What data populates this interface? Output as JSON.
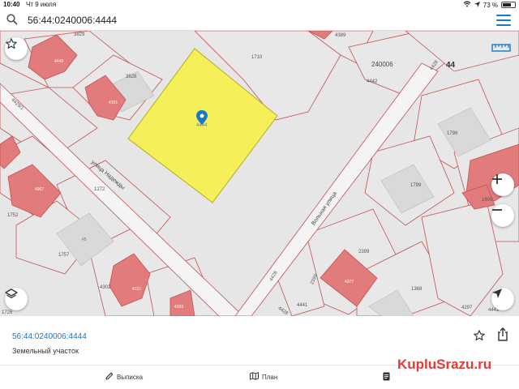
{
  "status": {
    "time": "10:40",
    "date": "Чт 9 июля",
    "battery": "73 %",
    "battery_level": 0.73
  },
  "search": {
    "query": "56:44:0240006:4444"
  },
  "map": {
    "block": "240006",
    "big_number": "44",
    "parcel_label": "4444",
    "parcel_color": "#f5ef5a",
    "building_color": "#e27b7b",
    "border_color": "#c45050",
    "streets": {
      "nadezhdy": "улица Надежды",
      "volnaya": "Вольная улица"
    },
    "labels": {
      "n3829": "3829",
      "n4389": "4389",
      "n1710": "1710",
      "n4442": "4442",
      "n4428a": "4428",
      "n3828": "3828",
      "n1798": "1798",
      "n1799": "1799",
      "n1699": "1699",
      "n1272": "1272",
      "n1752": "1752",
      "n1757": "1757",
      "n4302": "4302",
      "n2399a": "2399",
      "n2399b": "2399",
      "n1368": "1368",
      "n4428b": "4428",
      "n4441a": "4441",
      "n4441b": "4441",
      "n4297": "4297",
      "n4429": "4429/1",
      "n1726": "1726",
      "n4428c": "4428"
    },
    "bld_labels": {
      "b4449": "4449",
      "b4151": "4151",
      "b4967": "4967",
      "b4131": "4131",
      "b4303": "4303",
      "b4377": "4377",
      "b45": "45"
    }
  },
  "panel": {
    "cadastral": "56:44:0240006:4444",
    "type": "Земельный участок"
  },
  "tabs": {
    "extract": "Выписка",
    "plan": "План"
  },
  "watermark": "KupluSrazu.ru"
}
